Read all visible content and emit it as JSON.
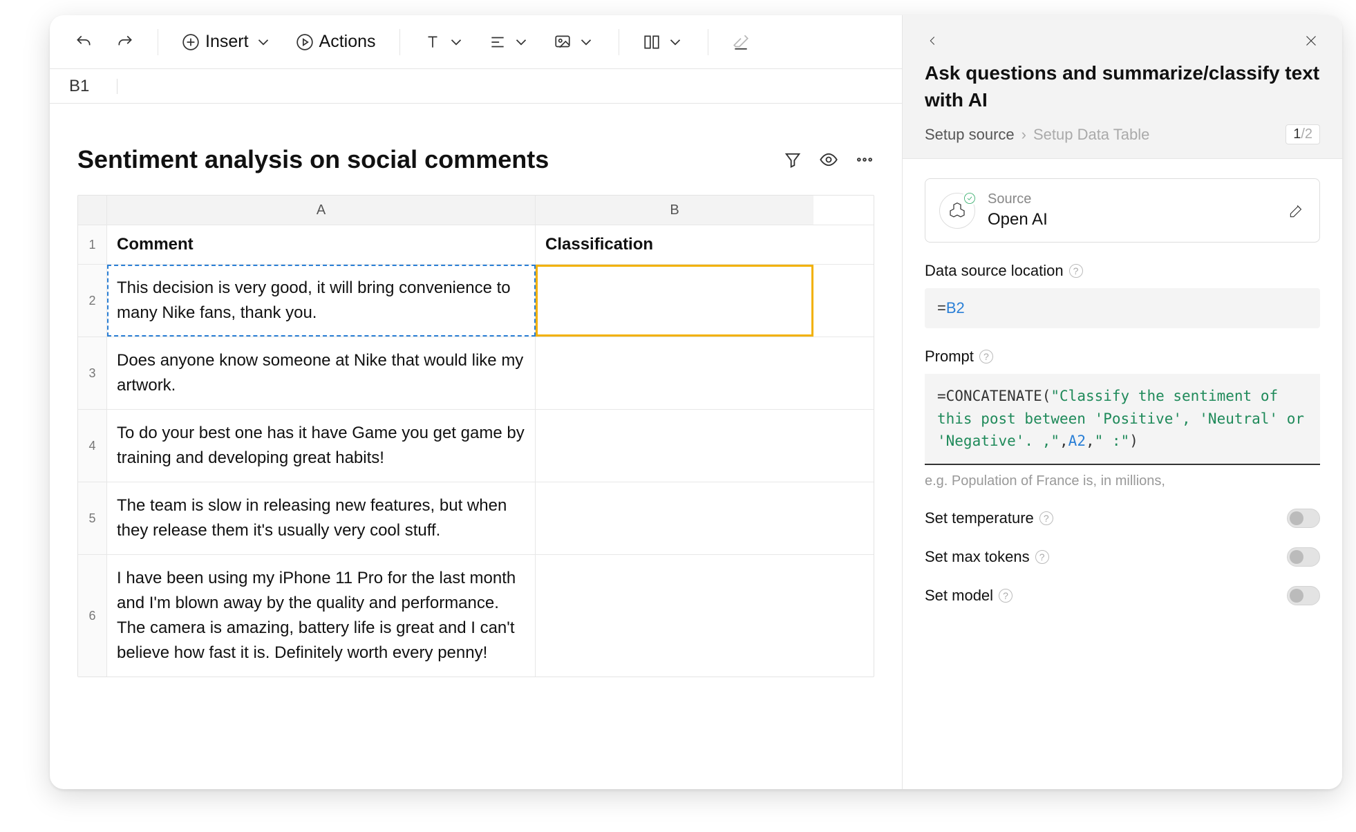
{
  "toolbar": {
    "insert_label": "Insert",
    "actions_label": "Actions"
  },
  "cellref": "B1",
  "sheet": {
    "title": "Sentiment analysis on social comments",
    "columns": [
      "A",
      "B"
    ],
    "headers": {
      "A": "Comment",
      "B": "Classification"
    },
    "rows": [
      {
        "n": "1"
      },
      {
        "n": "2",
        "A": "This decision is very good, it will bring convenience to many Nike fans, thank you."
      },
      {
        "n": "3",
        "A": "Does anyone know someone at Nike that would like my artwork."
      },
      {
        "n": "4",
        "A": "To do your best one has it have Game you get game by training and developing great habits!"
      },
      {
        "n": "5",
        "A": "The team is slow in releasing new features, but when they release them it's usually very cool stuff."
      },
      {
        "n": "6",
        "A": "I have been using my iPhone 11 Pro for the last month and I'm blown away by the quality and performance. The camera is amazing, battery life is great and I can't believe how fast it is. Definitely worth every penny!"
      }
    ]
  },
  "panel": {
    "title": "Ask questions and summarize/classify text with AI",
    "breadcrumb": {
      "active": "Setup source",
      "inactive": "Setup Data Table"
    },
    "step": {
      "current": "1",
      "total": "/2"
    },
    "source": {
      "label": "Source",
      "name": "Open AI"
    },
    "data_source": {
      "label": "Data source location",
      "eq": "=",
      "ref": "B2"
    },
    "prompt": {
      "label": "Prompt",
      "eq": "=",
      "fn": "CONCATENATE",
      "open": "(",
      "str1": "\"Classify the sentiment of this post between 'Positive', 'Neutral' or 'Negative'. ,\"",
      "sep": ",",
      "ref": "A2",
      "sep2": ",",
      "str2": "\" :\"",
      "close": ")",
      "hint": "e.g. Population of France is, in millions,"
    },
    "toggles": {
      "temperature": "Set temperature",
      "max_tokens": "Set max tokens",
      "model": "Set model"
    }
  }
}
